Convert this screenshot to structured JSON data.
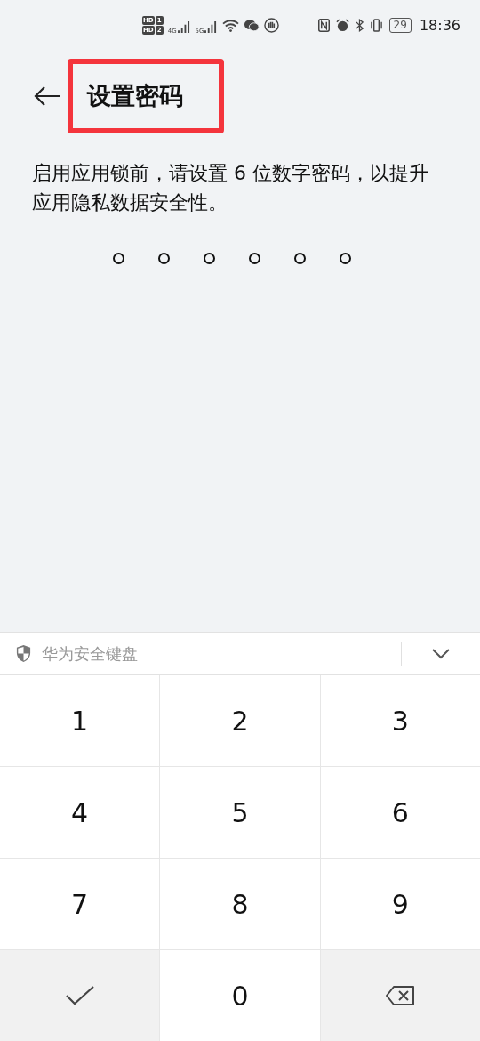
{
  "status_bar": {
    "hd_badges": [
      {
        "label": "HD",
        "sim": "1"
      },
      {
        "label": "HD",
        "sim": "2"
      }
    ],
    "networks": [
      "4G",
      "5G"
    ],
    "battery": "29",
    "time": "18:36"
  },
  "header": {
    "title": "设置密码",
    "highlighted": true
  },
  "description": "启用应用锁前，请设置 6 位数字密码，以提升应用隐私数据安全性。",
  "pin_dots": [
    {
      "filled": false
    },
    {
      "filled": false
    },
    {
      "filled": false
    },
    {
      "filled": false
    },
    {
      "filled": false
    },
    {
      "filled": false
    }
  ],
  "keyboard": {
    "title": "华为安全键盘",
    "keys": [
      {
        "kind": "digit",
        "label": "1"
      },
      {
        "kind": "digit",
        "label": "2"
      },
      {
        "kind": "digit",
        "label": "3"
      },
      {
        "kind": "digit",
        "label": "4"
      },
      {
        "kind": "digit",
        "label": "5"
      },
      {
        "kind": "digit",
        "label": "6"
      },
      {
        "kind": "digit",
        "label": "7"
      },
      {
        "kind": "digit",
        "label": "8"
      },
      {
        "kind": "digit",
        "label": "9"
      },
      {
        "kind": "confirm"
      },
      {
        "kind": "digit",
        "label": "0"
      },
      {
        "kind": "delete"
      }
    ]
  }
}
